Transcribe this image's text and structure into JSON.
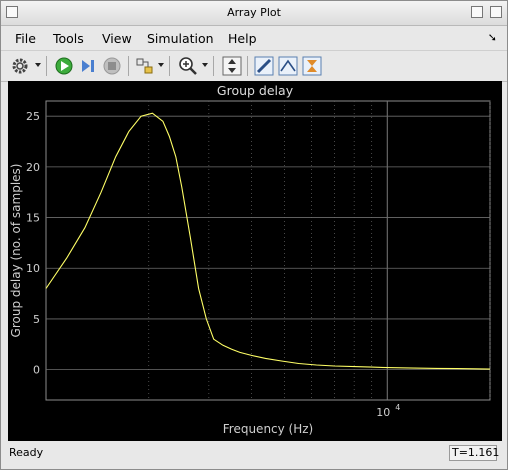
{
  "window": {
    "title": "Array Plot"
  },
  "menu": {
    "file": "File",
    "tools": "Tools",
    "view": "View",
    "simulation": "Simulation",
    "help": "Help"
  },
  "toolbar": {
    "icons": [
      "gear-icon",
      "run-icon",
      "step-forward-icon",
      "stop-icon",
      "signal-select-icon",
      "zoom-icon",
      "scale-axes-icon",
      "measurement-icon",
      "peak-finder-icon",
      "cursor-icon"
    ]
  },
  "plot": {
    "title": "Group delay",
    "background": "#000000",
    "trace_color": "#ffff66"
  },
  "chart_data": {
    "type": "line",
    "title": "Group delay",
    "xlabel": "Frequency (Hz)",
    "ylabel": "Group delay (no. of samples)",
    "xscale": "log",
    "yticks": [
      0,
      5,
      10,
      15,
      20,
      25
    ],
    "ytick_labels": [
      "0",
      "5",
      "10",
      "15",
      "20",
      "25"
    ],
    "xtick_label": "10",
    "xtick_exponent": "4",
    "ylim": [
      -3,
      26.5
    ],
    "grid": true,
    "series": [
      {
        "x": [
          1000,
          1150,
          1300,
          1450,
          1600,
          1750,
          1900,
          2050,
          2200,
          2300,
          2400,
          2500,
          2650,
          2800,
          2950,
          3100,
          3300,
          3500,
          3700,
          4000,
          4400,
          4900,
          5500,
          6200,
          7000,
          8000,
          9000,
          10000,
          12000,
          14000,
          16000,
          18000,
          20000
        ],
        "y": [
          8,
          11,
          14,
          17.5,
          21,
          23.5,
          25,
          25.3,
          24.5,
          23,
          21,
          18,
          13,
          8,
          5,
          3,
          2.4,
          2,
          1.7,
          1.4,
          1.1,
          0.85,
          0.6,
          0.45,
          0.35,
          0.3,
          0.25,
          0.2,
          0.15,
          0.12,
          0.1,
          0.08,
          0.05
        ]
      }
    ]
  },
  "status": {
    "text": "Ready",
    "time": "T=1.161"
  }
}
